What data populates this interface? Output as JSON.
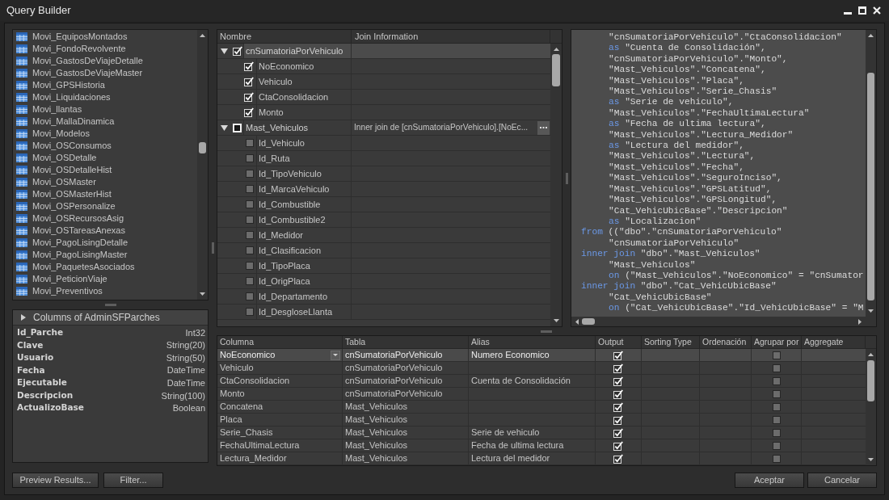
{
  "window": {
    "title": "Query Builder"
  },
  "table_list": {
    "items": [
      "Movi_EquiposMontados",
      "Movi_FondoRevolvente",
      "Movi_GastosDeViajeDetalle",
      "Movi_GastosDeViajeMaster",
      "Movi_GPSHistoria",
      "Movi_Liquidaciones",
      "Movi_llantas",
      "Movi_MallaDinamica",
      "Movi_Modelos",
      "Movi_OSConsumos",
      "Movi_OSDetalle",
      "Movi_OSDetalleHist",
      "Movi_OSMaster",
      "Movi_OSMasterHist",
      "Movi_OSPersonalize",
      "Movi_OSRecursosAsig",
      "Movi_OSTareasAnexas",
      "Movi_PagoLisingDetalle",
      "Movi_PagoLisingMaster",
      "Movi_PaquetesAsociados",
      "Movi_PeticionViaje",
      "Movi_Preventivos"
    ]
  },
  "columns_panel": {
    "title": "Columns of AdminSFParches",
    "columns": [
      {
        "name": "Id_Parche",
        "type": "Int32"
      },
      {
        "name": "Clave",
        "type": "String(20)"
      },
      {
        "name": "Usuario",
        "type": "String(50)"
      },
      {
        "name": "Fecha",
        "type": "DateTime"
      },
      {
        "name": "Ejecutable",
        "type": "DateTime"
      },
      {
        "name": "Descripcion",
        "type": "String(100)"
      },
      {
        "name": "ActualizoBase",
        "type": "Boolean"
      }
    ]
  },
  "tree": {
    "columns": [
      "Nombre",
      "Join Information"
    ],
    "tables": [
      {
        "name": "cnSumatoriaPorVehiculo",
        "expanded": true,
        "checked": true,
        "indeterminate": false,
        "selected": true,
        "children": [
          {
            "name": "NoEconomico",
            "checked": true
          },
          {
            "name": "Vehiculo",
            "checked": true
          },
          {
            "name": "CtaConsolidacion",
            "checked": true
          },
          {
            "name": "Monto",
            "checked": true
          }
        ]
      },
      {
        "name": "Mast_Vehiculos",
        "expanded": true,
        "checked": false,
        "indeterminate": true,
        "selected": false,
        "join": "Inner join de [cnSumatoriaPorVehiculo].[NoEc...",
        "children": [
          {
            "name": "Id_Vehiculo",
            "checked": false
          },
          {
            "name": "Id_Ruta",
            "checked": false
          },
          {
            "name": "Id_TipoVehiculo",
            "checked": false
          },
          {
            "name": "Id_MarcaVehiculo",
            "checked": false
          },
          {
            "name": "Id_Combustible",
            "checked": false
          },
          {
            "name": "Id_Combustible2",
            "checked": false
          },
          {
            "name": "Id_Medidor",
            "checked": false
          },
          {
            "name": "Id_Clasificacion",
            "checked": false
          },
          {
            "name": "Id_TipoPlaca",
            "checked": false
          },
          {
            "name": "Id_OrigPlaca",
            "checked": false
          },
          {
            "name": "Id_Departamento",
            "checked": false
          },
          {
            "name": "Id_DesgloseLlanta",
            "checked": false
          }
        ]
      }
    ]
  },
  "sql": {
    "lines": [
      {
        "indented": true,
        "text": "\"cnSumatoriaPorVehiculo\".\"CtaConsolidacion\""
      },
      {
        "indented": true,
        "keyword": "as",
        "text": "\"Cuenta de Consolidación\","
      },
      {
        "indented": true,
        "text": "\"cnSumatoriaPorVehiculo\".\"Monto\","
      },
      {
        "indented": true,
        "text": "\"Mast_Vehiculos\".\"Concatena\","
      },
      {
        "indented": true,
        "text": "\"Mast_Vehiculos\".\"Placa\","
      },
      {
        "indented": true,
        "text": "\"Mast_Vehiculos\".\"Serie_Chasis\""
      },
      {
        "indented": true,
        "keyword": "as",
        "text": "\"Serie de vehiculo\","
      },
      {
        "indented": true,
        "text": "\"Mast_Vehiculos\".\"FechaUltimaLectura\""
      },
      {
        "indented": true,
        "keyword": "as",
        "text": "\"Fecha de ultima lectura\","
      },
      {
        "indented": true,
        "text": "\"Mast_Vehiculos\".\"Lectura_Medidor\""
      },
      {
        "indented": true,
        "keyword": "as",
        "text": "\"Lectura del medidor\","
      },
      {
        "indented": true,
        "text": "\"Mast_Vehiculos\".\"Lectura\","
      },
      {
        "indented": true,
        "text": "\"Mast_Vehiculos\".\"Fecha\","
      },
      {
        "indented": true,
        "text": "\"Mast_Vehiculos\".\"SeguroInciso\","
      },
      {
        "indented": true,
        "text": "\"Mast_Vehiculos\".\"GPSLatitud\","
      },
      {
        "indented": true,
        "text": "\"Mast_Vehiculos\".\"GPSLongitud\","
      },
      {
        "indented": true,
        "text": "\"Cat_VehicUbicBase\".\"Descripcion\""
      },
      {
        "indented": true,
        "keyword": "as",
        "text": "\"Localizacion\""
      },
      {
        "indented": false,
        "keyword": "from",
        "text": "((\"dbo\".\"cnSumatoriaPorVehiculo\""
      },
      {
        "indented": true,
        "text": "\"cnSumatoriaPorVehiculo\""
      },
      {
        "indented": false,
        "keyword": "inner join",
        "text": "\"dbo\".\"Mast_Vehiculos\""
      },
      {
        "indented": true,
        "text": "\"Mast_Vehiculos\""
      },
      {
        "indented": true,
        "keyword": "on",
        "text": "(\"Mast_Vehiculos\".\"NoEconomico\" = \"cnSumator"
      },
      {
        "indented": false,
        "keyword": "inner join",
        "text": "\"dbo\".\"Cat_VehicUbicBase\""
      },
      {
        "indented": true,
        "text": "\"Cat_VehicUbicBase\""
      },
      {
        "indented": true,
        "keyword": "on",
        "text": "(\"Cat_VehicUbicBase\".\"Id_VehicUbicBase\" = \"M"
      }
    ]
  },
  "grid": {
    "columns": [
      "Columna",
      "Tabla",
      "Alias",
      "Output",
      "Sorting Type",
      "Ordenación",
      "Agrupar por",
      "Aggregate"
    ],
    "rows": [
      {
        "column": "NoEconomico",
        "table": "cnSumatoriaPorVehiculo",
        "alias": "Numero Economico",
        "output": true,
        "group_by": false,
        "selected": true
      },
      {
        "column": "Vehiculo",
        "table": "cnSumatoriaPorVehiculo",
        "output": true,
        "group_by": false,
        "selected": false
      },
      {
        "column": "CtaConsolidacion",
        "table": "cnSumatoriaPorVehiculo",
        "alias": "Cuenta de Consolidación",
        "output": true,
        "group_by": false,
        "selected": false
      },
      {
        "column": "Monto",
        "table": "cnSumatoriaPorVehiculo",
        "output": true,
        "group_by": false,
        "selected": false
      },
      {
        "column": "Concatena",
        "table": "Mast_Vehiculos",
        "output": true,
        "group_by": false,
        "selected": false
      },
      {
        "column": "Placa",
        "table": "Mast_Vehiculos",
        "output": true,
        "group_by": false,
        "selected": false
      },
      {
        "column": "Serie_Chasis",
        "table": "Mast_Vehiculos",
        "alias": "Serie de vehiculo",
        "output": true,
        "group_by": false,
        "selected": false
      },
      {
        "column": "FechaUltimaLectura",
        "table": "Mast_Vehiculos",
        "alias": "Fecha de ultima lectura",
        "output": true,
        "group_by": false,
        "selected": false
      },
      {
        "column": "Lectura_Medidor",
        "table": "Mast_Vehiculos",
        "alias": "Lectura del medidor",
        "output": true,
        "group_by": false,
        "selected": false
      }
    ]
  },
  "buttons_left": [
    "Preview Results...",
    "Filter..."
  ],
  "buttons_right": [
    "Aceptar",
    "Cancelar"
  ]
}
